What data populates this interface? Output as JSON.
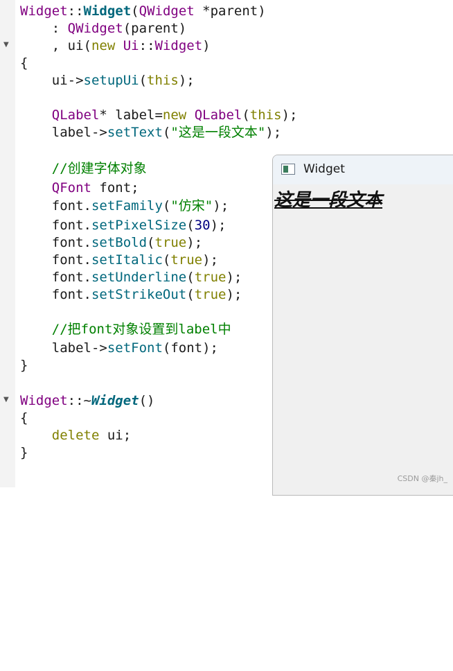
{
  "editor": {
    "lines": {
      "l1": {
        "a": "Widget",
        "b": "::",
        "c": "Widget",
        "d": "(",
        "e": "QWidget",
        "f": " *parent)"
      },
      "l2": {
        "a": "    : ",
        "b": "QWidget",
        "c": "(parent)"
      },
      "l3": {
        "a": "    , ui(",
        "b": "new",
        "c": " ",
        "d": "Ui",
        "e": "::",
        "f": "Widget",
        "g": ")"
      },
      "l4": {
        "a": "{"
      },
      "l5": {
        "a": "    ui->",
        "b": "setupUi",
        "c": "(",
        "d": "this",
        "e": ");"
      },
      "l6": {
        "a": "    ",
        "b": "QLabel",
        "c": "* label=",
        "d": "new",
        "e": " ",
        "f": "QLabel",
        "g": "(",
        "h": "this",
        "i": ");"
      },
      "l7": {
        "a": "    label->",
        "b": "setText",
        "c": "(",
        "d": "\"这是一段文本\"",
        "e": ");"
      },
      "l8": {
        "a": "    ",
        "b": "//创建字体对象"
      },
      "l9": {
        "a": "    ",
        "b": "QFont",
        "c": " font;"
      },
      "l10": {
        "a": "    font.",
        "b": "setFamily",
        "c": "(",
        "d": "\"仿宋\"",
        "e": ");"
      },
      "l11": {
        "a": "    font.",
        "b": "setPixelSize",
        "c": "(",
        "d": "30",
        "e": ");"
      },
      "l12": {
        "a": "    font.",
        "b": "setBold",
        "c": "(",
        "d": "true",
        "e": ");"
      },
      "l13": {
        "a": "    font.",
        "b": "setItalic",
        "c": "(",
        "d": "true",
        "e": ");"
      },
      "l14": {
        "a": "    font.",
        "b": "setUnderline",
        "c": "(",
        "d": "true",
        "e": ");"
      },
      "l15": {
        "a": "    font.",
        "b": "setStrikeOut",
        "c": "(",
        "d": "true",
        "e": ");"
      },
      "l16": {
        "a": "    ",
        "b": "//把font对象设置到label中"
      },
      "l17": {
        "a": "    label->",
        "b": "setFont",
        "c": "(font);"
      },
      "l18": {
        "a": "}"
      },
      "l19": {
        "a": "Widget",
        "b": "::~",
        "c": "Widget",
        "d": "()"
      },
      "l20": {
        "a": "{"
      },
      "l21": {
        "a": "    ",
        "b": "delete",
        "c": " ui;"
      },
      "l22": {
        "a": "}"
      }
    },
    "fold_icon": "triangle-down-icon"
  },
  "preview_window": {
    "title": "Widget",
    "icon": "app-window-icon",
    "label_text": "这是一段文本"
  },
  "watermark": "CSDN @秦jh_"
}
